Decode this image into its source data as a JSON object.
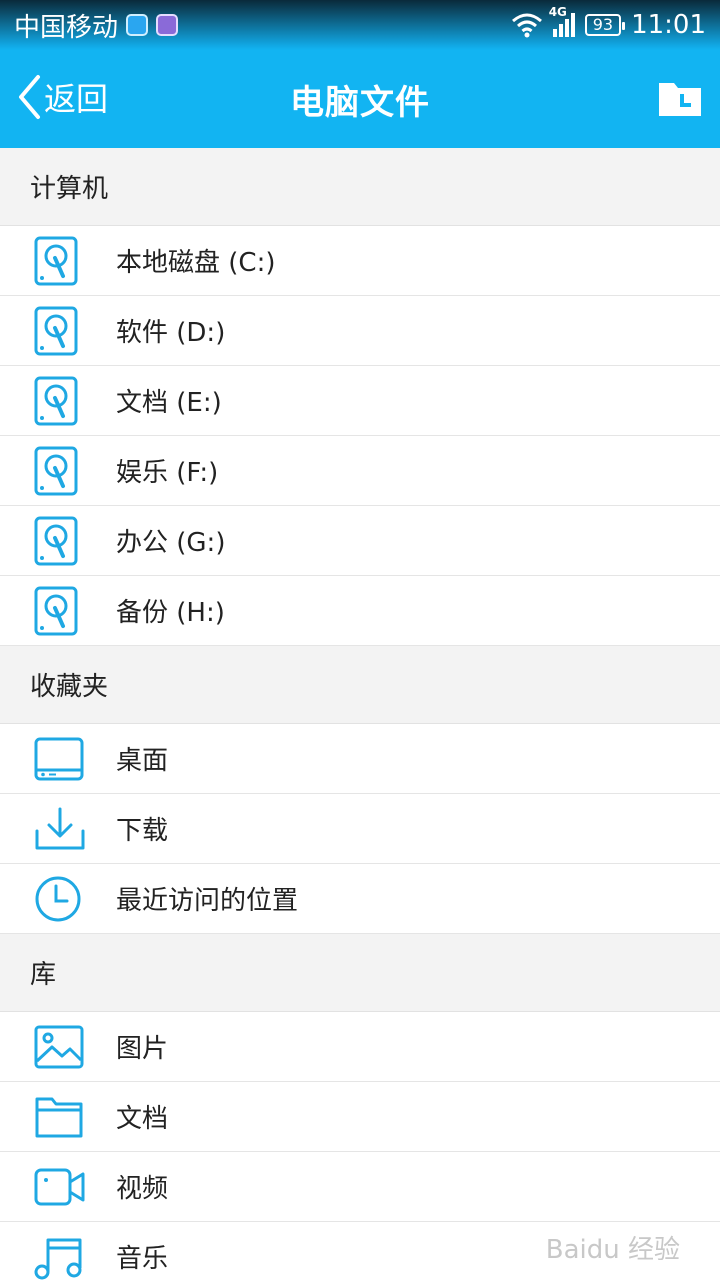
{
  "statusbar": {
    "carrier": "中国移动",
    "network": "4G",
    "battery": "93",
    "time": "11:01"
  },
  "header": {
    "back_label": "返回",
    "title": "电脑文件"
  },
  "sections": [
    {
      "title": "计算机",
      "items": [
        {
          "label": "本地磁盘 (C:)",
          "icon": "hard-disk-icon"
        },
        {
          "label": "软件 (D:)",
          "icon": "hard-disk-icon"
        },
        {
          "label": "文档 (E:)",
          "icon": "hard-disk-icon"
        },
        {
          "label": "娱乐 (F:)",
          "icon": "hard-disk-icon"
        },
        {
          "label": "办公 (G:)",
          "icon": "hard-disk-icon"
        },
        {
          "label": "备份 (H:)",
          "icon": "hard-disk-icon"
        }
      ]
    },
    {
      "title": "收藏夹",
      "items": [
        {
          "label": "桌面",
          "icon": "desktop-icon"
        },
        {
          "label": "下载",
          "icon": "download-icon"
        },
        {
          "label": "最近访问的位置",
          "icon": "clock-icon"
        }
      ]
    },
    {
      "title": "库",
      "items": [
        {
          "label": "图片",
          "icon": "picture-icon"
        },
        {
          "label": "文档",
          "icon": "folder-icon"
        },
        {
          "label": "视频",
          "icon": "video-icon"
        },
        {
          "label": "音乐",
          "icon": "music-icon"
        }
      ]
    }
  ],
  "watermark": "Baidu 经验",
  "colors": {
    "accent": "#12b4f2",
    "icon": "#1fa8e3"
  }
}
